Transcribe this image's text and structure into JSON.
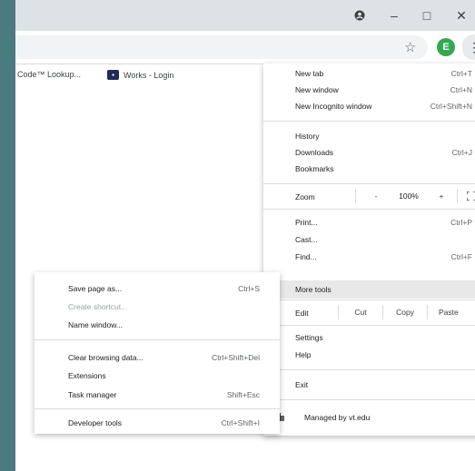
{
  "window": {
    "controls": {
      "minimize": "–",
      "maximize": "□",
      "close": "✕"
    },
    "account_icon": "account-circle-icon"
  },
  "toolbar": {
    "star_glyph": "☆",
    "avatar_letter": "E",
    "menu_glyph": "⋮"
  },
  "bookmarks": [
    {
      "label": "Code™ Lookup..."
    },
    {
      "label": "Works - Login"
    }
  ],
  "menu": {
    "new_tab": {
      "label": "New tab",
      "shortcut": "Ctrl+T"
    },
    "new_window": {
      "label": "New window",
      "shortcut": "Ctrl+N"
    },
    "new_incognito": {
      "label": "New Incognito window",
      "shortcut": "Ctrl+Shift+N"
    },
    "history": {
      "label": "History"
    },
    "downloads": {
      "label": "Downloads",
      "shortcut": "Ctrl+J"
    },
    "bookmarks": {
      "label": "Bookmarks"
    },
    "zoom": {
      "label": "Zoom",
      "minus": "-",
      "value": "100%",
      "plus": "+"
    },
    "print": {
      "label": "Print...",
      "shortcut": "Ctrl+P"
    },
    "cast": {
      "label": "Cast..."
    },
    "find": {
      "label": "Find...",
      "shortcut": "Ctrl+F"
    },
    "more_tools": {
      "label": "More tools"
    },
    "edit": {
      "label": "Edit",
      "cut": "Cut",
      "copy": "Copy",
      "paste": "Paste"
    },
    "settings": {
      "label": "Settings"
    },
    "help": {
      "label": "Help"
    },
    "exit": {
      "label": "Exit"
    },
    "managed": {
      "label": "Managed by vt.edu"
    }
  },
  "submenu": {
    "save_page": {
      "label": "Save page as...",
      "shortcut": "Ctrl+S"
    },
    "create_shortcut": {
      "label": "Create shortcut..."
    },
    "name_window": {
      "label": "Name window..."
    },
    "clear_browsing": {
      "label": "Clear browsing data...",
      "shortcut": "Ctrl+Shift+Del"
    },
    "extensions": {
      "label": "Extensions"
    },
    "task_manager": {
      "label": "Task manager",
      "shortcut": "Shift+Esc"
    },
    "developer_tools": {
      "label": "Developer tools",
      "shortcut": "Ctrl+Shift+I"
    }
  }
}
